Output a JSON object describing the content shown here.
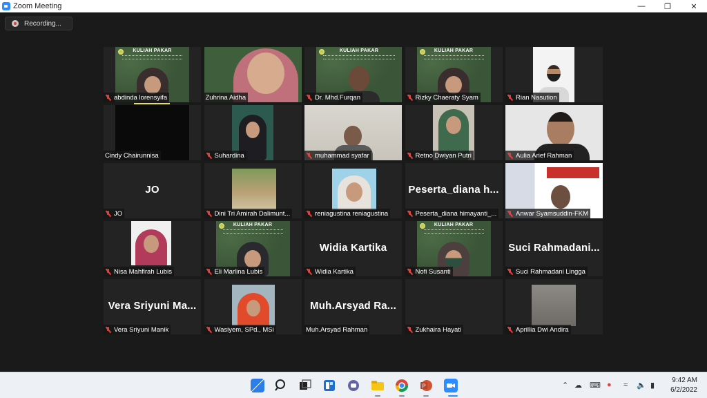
{
  "window": {
    "title": "Zoom Meeting",
    "controls": [
      "minimize",
      "maximize",
      "close"
    ]
  },
  "recording": {
    "label": "Recording..."
  },
  "participants": [
    {
      "name": "abdinda lorensyifa",
      "muted": true,
      "video": "banner-hijab"
    },
    {
      "name": "Zuhrina Aidha",
      "muted": false,
      "video": "closeup-hijab",
      "active_speaker": true
    },
    {
      "name": "Dr. Mhd.Furqan",
      "muted": true,
      "video": "banner-man"
    },
    {
      "name": "Rizky Chaeraty Syam",
      "muted": true,
      "video": "banner-hijab"
    },
    {
      "name": "Rian Nasution",
      "muted": true,
      "video": "man-mask"
    },
    {
      "name": "Cindy Chairunnisa",
      "muted": false,
      "video": "off"
    },
    {
      "name": "Suhardina",
      "muted": true,
      "video": "hijab-dark"
    },
    {
      "name": "muhammad syafar",
      "muted": true,
      "video": "room-man"
    },
    {
      "name": "Retno Dwiyan Putri",
      "muted": true,
      "video": "hijab-green"
    },
    {
      "name": "Aulia Arief Rahman",
      "muted": true,
      "video": "man-glasses"
    },
    {
      "name": "JO",
      "muted": true,
      "display_name": "JO",
      "video": "none"
    },
    {
      "name": "Dini Tri Amirah Dalimunt...",
      "muted": true,
      "video": "picnic"
    },
    {
      "name": "reniagustina reniagustina",
      "muted": true,
      "video": "hijab-photo"
    },
    {
      "name": "Peserta_diana himayanti_...",
      "muted": true,
      "display_name": "Peserta_diana  h...",
      "video": "none"
    },
    {
      "name": "Anwar Syamsuddin-FKM",
      "muted": true,
      "video": "poster"
    },
    {
      "name": "Nisa Mahfirah Lubis",
      "muted": true,
      "video": "hijab-pink"
    },
    {
      "name": "Eli Marlina Lubis",
      "muted": true,
      "video": "banner-hijab-dark"
    },
    {
      "name": "Widia Kartika",
      "muted": true,
      "display_name": "Widia Kartika",
      "video": "none"
    },
    {
      "name": "Nofi Susanti",
      "muted": true,
      "video": "banner-hijab-mask"
    },
    {
      "name": "Suci Rahmadani Lingga",
      "muted": true,
      "display_name": "Suci  Rahmadani...",
      "video": "none"
    },
    {
      "name": "Vera Sriyuni Manik",
      "muted": true,
      "display_name": "Vera Sriyuni  Ma...",
      "video": "none"
    },
    {
      "name": "Wasiyem, SPd., MSi",
      "muted": true,
      "video": "hijab-orange"
    },
    {
      "name": "Muh.Arsyad Rahman",
      "muted": false,
      "display_name": "Muh.Arsyad  Ra...",
      "video": "none"
    },
    {
      "name": "Zukhaira Hayati",
      "muted": true,
      "video": "off-blank"
    },
    {
      "name": "Aprillia Dwi Andira",
      "muted": true,
      "video": "room-photo"
    }
  ],
  "banner": {
    "title": "KULIAH PAKAR"
  },
  "taskbar": {
    "apps": [
      "windows-start",
      "search",
      "task-view",
      "widgets",
      "teams-chat",
      "file-explorer",
      "chrome",
      "powerpoint",
      "zoom"
    ],
    "tray": [
      "chevron-up",
      "onedrive",
      "keyboard",
      "microphone",
      "wifi",
      "volume",
      "battery"
    ],
    "time": "9:42 AM",
    "date": "6/2/2022"
  },
  "colors": {
    "active_speaker_border": "#d8e34a",
    "mic_muted": "#e0443e",
    "stage_background": "#1a1a1a",
    "banner_green": "#3d5a3a"
  }
}
